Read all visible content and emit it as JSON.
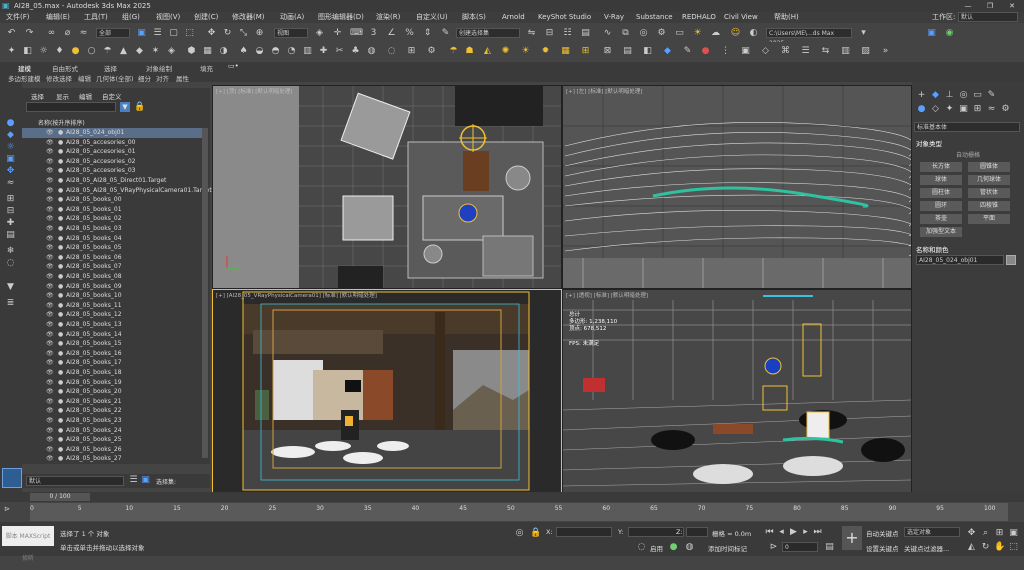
{
  "window": {
    "title": "AI28_05.max - Autodesk 3ds Max 2025",
    "min": "—",
    "max": "❐",
    "close": "✕"
  },
  "menu": [
    "文件(F)",
    "编辑(E)",
    "工具(T)",
    "组(G)",
    "视图(V)",
    "创建(C)",
    "修改器(M)",
    "动画(A)",
    "图形编辑器(D)",
    "渲染(R)",
    "自定义(U)",
    "脚本(S)",
    "Arnold",
    "KeyShot Studio",
    "V-Ray",
    "Substance",
    "REDHALO",
    "Civil View",
    "帮助(H)"
  ],
  "workspace": {
    "label": "工作区:",
    "value": "默认"
  },
  "toolbar": {
    "filter": "全部",
    "viewDropdown": "视图",
    "selectionSet": "创建选择集",
    "projectPath": "C:\\Users\\ME\\...ds Max 2025"
  },
  "ribbon": {
    "tabs": [
      "建模",
      "自由形式",
      "选择",
      "对象绘制",
      "填充"
    ],
    "subtabs": [
      "多边形建模",
      "修改选择",
      "编辑",
      "几何体(全部)",
      "细分",
      "对齐",
      "属性"
    ]
  },
  "explorer": {
    "tabs": [
      "选择",
      "显示",
      "编辑",
      "自定义"
    ],
    "header": "名称(按升序排序)",
    "items": [
      "AI28_05_024_obj01",
      "AI28_05_accesories_00",
      "AI28_05_accesories_01",
      "AI28_05_accesories_02",
      "AI28_05_accesories_03",
      "AI28_05_AI28_05_Direct01.Target",
      "AI28_05_AI28_05_VRayPhysicalCamera01.Target",
      "AI28_05_books_00",
      "AI28_05_books_01",
      "AI28_05_books_02",
      "AI28_05_books_03",
      "AI28_05_books_04",
      "AI28_05_books_05",
      "AI28_05_books_06",
      "AI28_05_books_07",
      "AI28_05_books_08",
      "AI28_05_books_09",
      "AI28_05_books_10",
      "AI28_05_books_11",
      "AI28_05_books_12",
      "AI28_05_books_13",
      "AI28_05_books_14",
      "AI28_05_books_15",
      "AI28_05_books_16",
      "AI28_05_books_17",
      "AI28_05_books_18",
      "AI28_05_books_19",
      "AI28_05_books_20",
      "AI28_05_books_21",
      "AI28_05_books_22",
      "AI28_05_books_23",
      "AI28_05_books_24",
      "AI28_05_books_25",
      "AI28_05_books_26",
      "AI28_05_books_27"
    ],
    "layer": "默认",
    "selectionSet": "选择集:"
  },
  "viewports": {
    "top": "[+] [顶] [标准] [默认明暗处理]",
    "front": "[+] [左] [标准] [默认明暗处理]",
    "camera": "[+] [AI28_05_VRayPhysicalCamera01] [标准] [默认明暗处理]",
    "persp": "[+] [透视] [标准] [默认明暗处理]",
    "stats": [
      "总计",
      "多边形: 1,238,110",
      "顶点: 678,512",
      "FPS: 未满足"
    ]
  },
  "command": {
    "dropdown": "标准基本体",
    "rollout1": "对象类型",
    "autogrid": "自动栅格",
    "buttons": [
      "长方体",
      "圆锥体",
      "球体",
      "几何球体",
      "圆柱体",
      "管状体",
      "圆环",
      "四棱锥",
      "茶壶",
      "平面",
      "加强型文本"
    ],
    "rollout2": "名称和颜色",
    "name": "AI28_05_024_obj01"
  },
  "timeline": {
    "frame": "0 / 100",
    "ticks": [
      "0",
      "5",
      "10",
      "15",
      "20",
      "25",
      "30",
      "35",
      "40",
      "45",
      "50",
      "55",
      "60",
      "65",
      "70",
      "75",
      "80",
      "85",
      "90",
      "95",
      "100"
    ]
  },
  "status": {
    "script": "脚本 MAXScript 侦听",
    "line1": "选择了 1 个 对象",
    "line2": "单击或单击并拖动以选择对象",
    "xLabel": "X:",
    "yLabel": "Y:",
    "zLabel": "Z:",
    "grid": "栅格 = 0.0m",
    "enable": "启用",
    "addTime": "添加时间标记",
    "autoKey": "自动关键点",
    "setKey": "设置关键点",
    "selected": "选定对象",
    "keyFilter": "关键点过滤器...",
    "frameValue": "0"
  },
  "colors": {
    "accent": "#5aa0ff",
    "selection": "#f0c030",
    "panel": "#3c3c3c"
  }
}
